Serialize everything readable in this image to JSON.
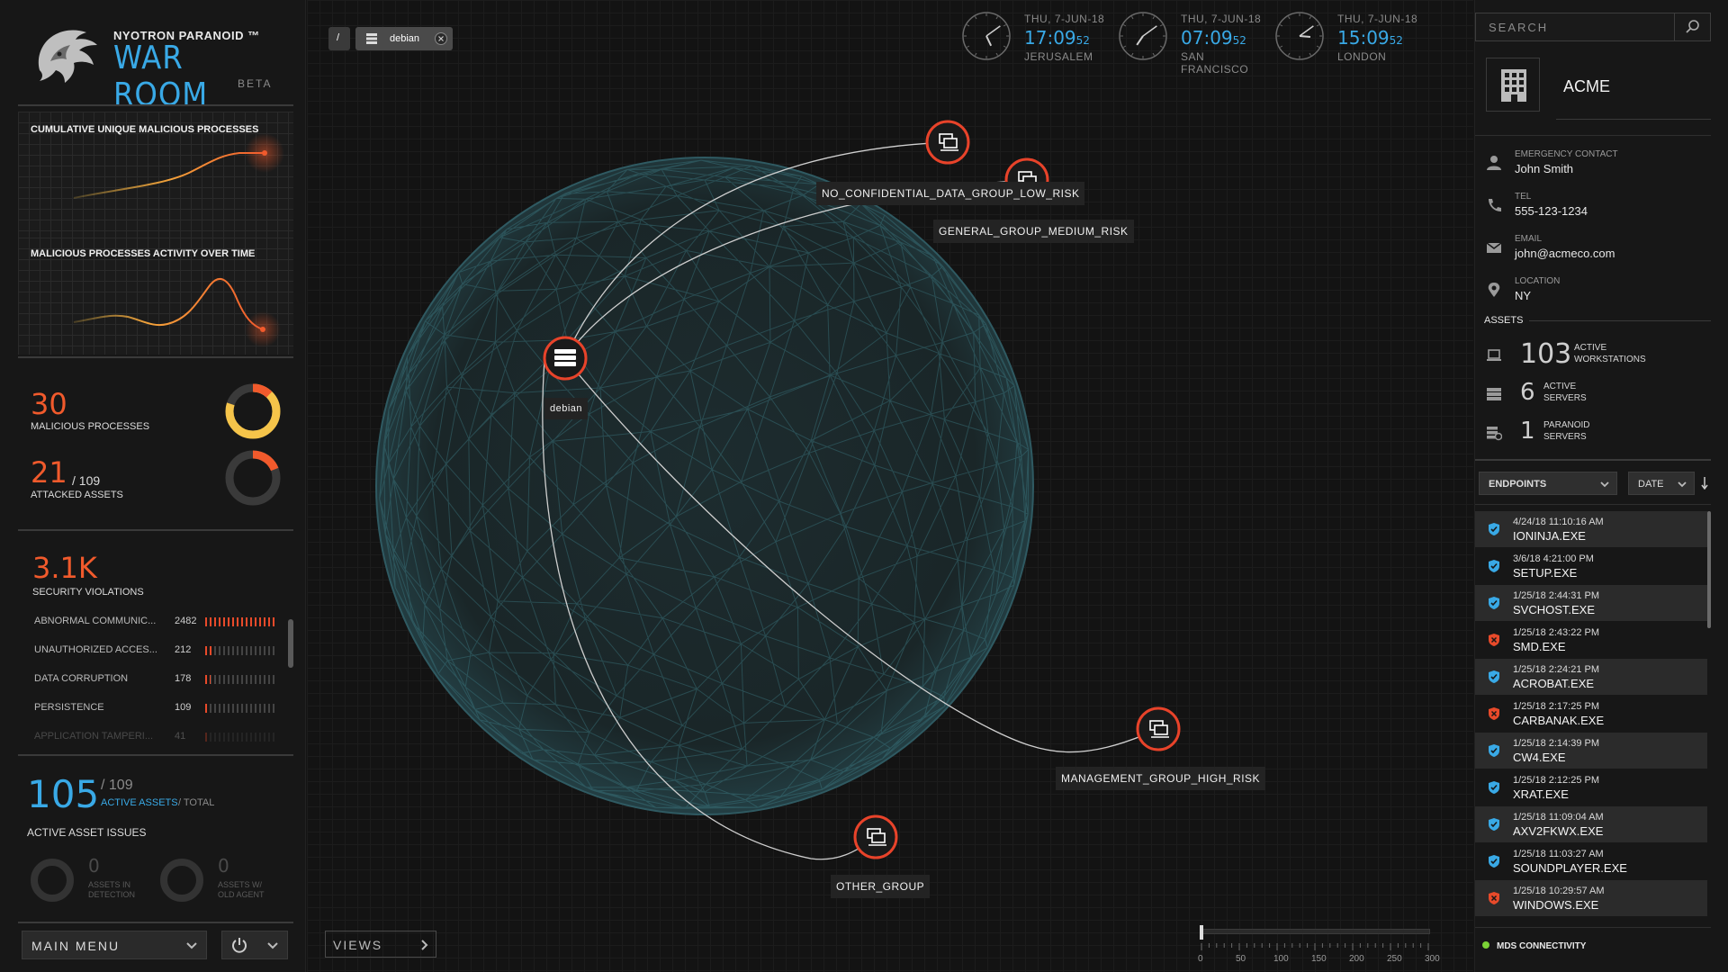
{
  "app": {
    "brand_sub": "NYOTRON PARANOID ™",
    "title": "WAR ROOM",
    "badge": "BETA"
  },
  "left": {
    "chart1_title": "CUMULATIVE UNIQUE MALICIOUS PROCESSES",
    "chart2_title": "MALICIOUS PROCESSES ACTIVITY OVER TIME",
    "malicious_count": "30",
    "malicious_label": "MALICIOUS PROCESSES",
    "malicious_ratio": 0.8,
    "attacked_count": "21",
    "attacked_total": "/ 109",
    "attacked_label": "ATTACKED ASSETS",
    "attacked_ratio": 0.19,
    "violations_value": "3.1K",
    "violations_label": "SECURITY VIOLATIONS",
    "violations": [
      {
        "name": "ABNORMAL COMMUNIC...",
        "value": "2482",
        "ratio": 1.0
      },
      {
        "name": "UNAUTHORIZED ACCES...",
        "value": "212",
        "ratio": 0.09
      },
      {
        "name": "DATA CORRUPTION",
        "value": "178",
        "ratio": 0.07
      },
      {
        "name": "PERSISTENCE",
        "value": "109",
        "ratio": 0.05
      },
      {
        "name": "APPLICATION TAMPERI...",
        "value": "41",
        "ratio": 0.02
      }
    ],
    "active_count": "105",
    "active_total": "/ 109",
    "active_label": "ACTIVE ASSETS",
    "active_total_label": "/ TOTAL",
    "issues_title": "ACTIVE ASSET ISSUES",
    "issue1_value": "0",
    "issue1_label_1": "ASSETS IN",
    "issue1_label_2": "DETECTION",
    "issue2_value": "0",
    "issue2_label_1": "ASSETS W/",
    "issue2_label_2": "OLD AGENT",
    "main_menu": "MAIN MENU"
  },
  "center": {
    "crumb_root": "/",
    "crumb_item": "debian",
    "clocks": [
      {
        "date": "THU, 7-JUN-18",
        "hm": "17:09",
        "sec": "52",
        "city": "JERUSALEM",
        "h": 17,
        "m": 9
      },
      {
        "date": "THU, 7-JUN-18",
        "hm": "07:09",
        "sec": "52",
        "city": "SAN FRANCISCO",
        "h": 7,
        "m": 9
      },
      {
        "date": "THU, 7-JUN-18",
        "hm": "15:09",
        "sec": "52",
        "city": "LONDON",
        "h": 15,
        "m": 9
      }
    ],
    "nodes": {
      "debian": "debian",
      "no_conf": "NO_CONFIDENTIAL_DATA_GROUP_LOW_RISK",
      "general": "GENERAL_GROUP_MEDIUM_RISK",
      "management": "MANAGEMENT_GROUP_HIGH_RISK",
      "other": "OTHER_GROUP"
    },
    "views": "VIEWS",
    "scale_ticks": [
      "0",
      "50",
      "100",
      "150",
      "200",
      "250",
      "300"
    ]
  },
  "right": {
    "search_placeholder": "SEARCH",
    "org_name": "ACME",
    "contact": [
      {
        "key": "EMERGENCY CONTACT",
        "value": "John Smith",
        "icon": "person-icon"
      },
      {
        "key": "TEL",
        "value": "555-123-1234",
        "icon": "phone-icon"
      },
      {
        "key": "EMAIL",
        "value": "john@acmeco.com",
        "icon": "mail-icon"
      },
      {
        "key": "LOCATION",
        "value": "NY",
        "icon": "location-pin-icon"
      }
    ],
    "assets_title": "ASSETS",
    "assets": [
      {
        "num": "103",
        "l1": "ACTIVE",
        "l2": "WORKSTATIONS"
      },
      {
        "num": "6",
        "l1": "ACTIVE",
        "l2": "SERVERS"
      },
      {
        "num": "1",
        "l1": "PARANOID",
        "l2": "SERVERS"
      }
    ],
    "filter_endpoints": "ENDPOINTS",
    "filter_date": "DATE",
    "endpoints": [
      {
        "date": "4/24/18  11:10:16 AM",
        "name": "IONINJA.EXE",
        "status": "safe"
      },
      {
        "date": "3/6/18  4:21:00 PM",
        "name": "SETUP.EXE",
        "status": "safe"
      },
      {
        "date": "1/25/18  2:44:31 PM",
        "name": "SVCHOST.EXE",
        "status": "safe"
      },
      {
        "date": "1/25/18  2:43:22 PM",
        "name": "SMD.EXE",
        "status": "threat"
      },
      {
        "date": "1/25/18  2:24:21 PM",
        "name": "ACROBAT.EXE",
        "status": "safe"
      },
      {
        "date": "1/25/18  2:17:25 PM",
        "name": "CARBANAK.EXE",
        "status": "threat"
      },
      {
        "date": "1/25/18  2:14:39 PM",
        "name": "CW4.EXE",
        "status": "safe"
      },
      {
        "date": "1/25/18  2:12:25 PM",
        "name": "XRAT.EXE",
        "status": "safe"
      },
      {
        "date": "1/25/18  11:09:04 AM",
        "name": "AXV2FKWX.EXE",
        "status": "safe"
      },
      {
        "date": "1/25/18  11:03:27 AM",
        "name": "SOUNDPLAYER.EXE",
        "status": "safe"
      },
      {
        "date": "1/25/18  10:29:57 AM",
        "name": "WINDOWS.EXE",
        "status": "threat"
      }
    ],
    "connectivity": "MDS CONNECTIVITY"
  },
  "colors": {
    "accent_blue": "#39a9e6",
    "alert_orange": "#f15a2c",
    "ring_yellow": "#f5c44a",
    "safe_shield": "#39a9e6",
    "threat_shield": "#e84a2a",
    "ok_green": "#7bd236"
  }
}
